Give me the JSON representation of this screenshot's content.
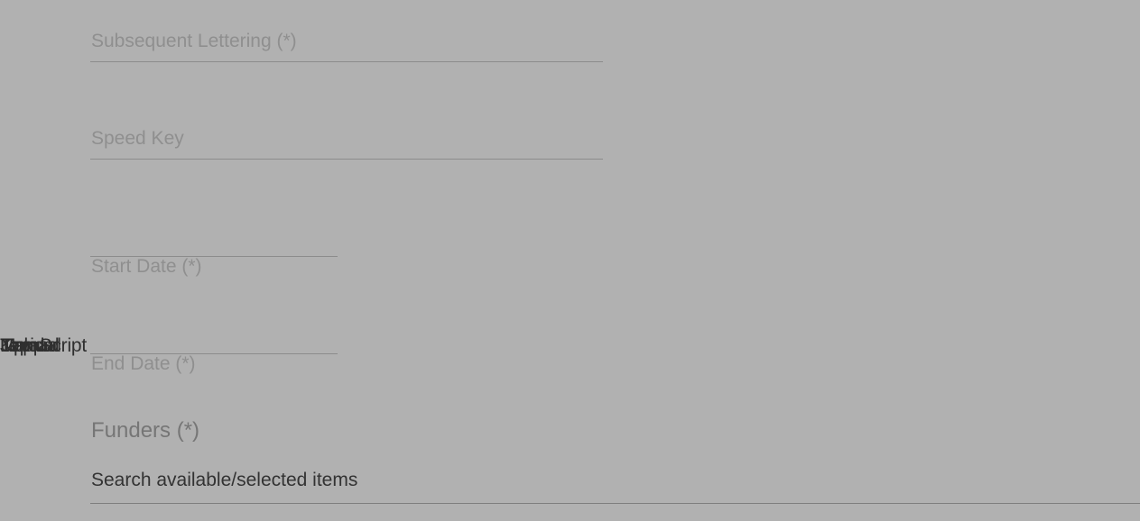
{
  "form": {
    "subsequent_lettering": {
      "placeholder": "Subsequent Lettering (*)"
    },
    "speed_key": {
      "placeholder": "Speed Key"
    },
    "start_date": {
      "label": "Start Date (*)"
    },
    "end_date": {
      "label": "End Date (*)"
    },
    "funders": {
      "heading": "Funders (*)",
      "search_text": "Search available/selected items"
    }
  },
  "overlapping_labels": [
    "Manual",
    "JavaScript",
    "Tepid",
    "Kappa",
    "Upload"
  ],
  "colors": {
    "background": "#b1b1b1",
    "placeholder": "#8f8f8f",
    "heading": "#767676",
    "text": "#333333"
  }
}
